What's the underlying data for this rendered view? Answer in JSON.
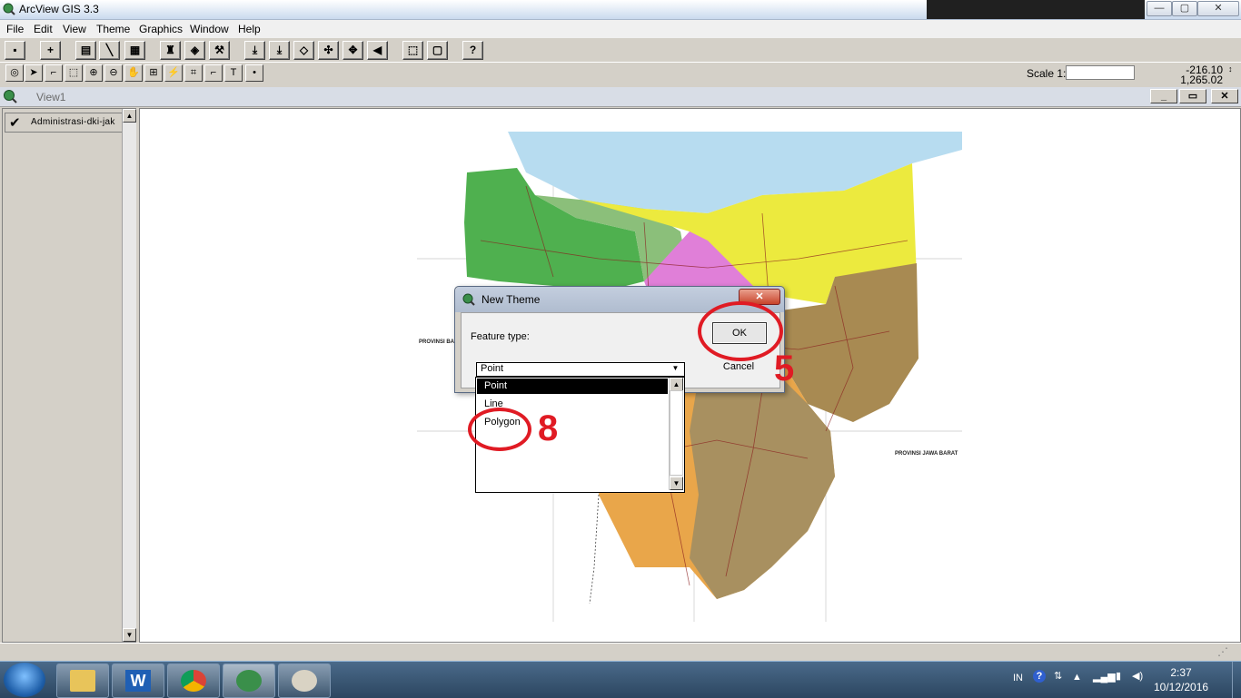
{
  "window": {
    "title": "ArcView GIS 3.3",
    "min": "—",
    "max": "▢",
    "close": "✕"
  },
  "menu": {
    "file": "File",
    "edit": "Edit",
    "view": "View",
    "theme": "Theme",
    "graphics": "Graphics",
    "window": "Window",
    "help": "Help"
  },
  "toolbar": {
    "scale_label": "Scale 1:",
    "coord_x": "-216.10",
    "coord_y": "1,265.02"
  },
  "view": {
    "title": "View1"
  },
  "toc": {
    "layer_label": "Administrasi-dki-jak"
  },
  "map": {
    "label_west": "PROVINSI BANTEN",
    "label_east": "PROVINSI JAWA BARAT"
  },
  "dialog": {
    "title": "New Theme",
    "feature_label": "Feature type:",
    "ok": "OK",
    "cancel": "Cancel",
    "selected": "Point",
    "options": [
      "Point",
      "Line",
      "Polygon"
    ]
  },
  "annotations": {
    "step_ok": "5",
    "step_polygon": "8"
  },
  "tray": {
    "lang": "IN",
    "time": "2:37",
    "date": "10/12/2016"
  },
  "colors": {
    "annotation": "#e01b24",
    "selection": "#000000"
  },
  "icons": [
    "arcview-icon",
    "save-icon",
    "add-theme-icon",
    "help-icon",
    "pointer-icon",
    "zoom-in-icon",
    "zoom-out-icon",
    "pan-icon",
    "text-tool-icon",
    "windows-start-icon",
    "explorer-icon",
    "word-icon",
    "chrome-icon",
    "arcview-task-icon",
    "paint-icon"
  ]
}
